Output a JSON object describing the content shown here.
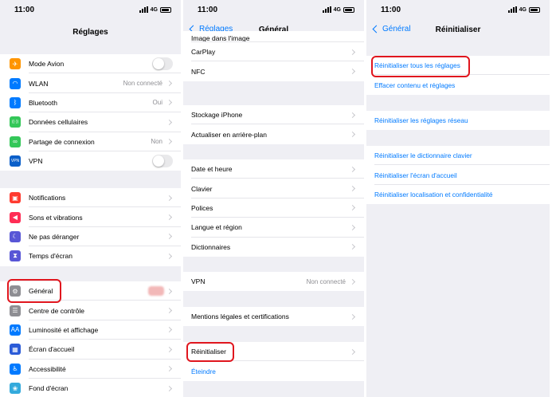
{
  "status": {
    "time": "11:00",
    "network": "4G"
  },
  "panel1": {
    "title": "Réglages",
    "group1": [
      {
        "label": "Mode Avion",
        "icon": "airplane-icon",
        "color": "#ff9500",
        "glyph": "✈",
        "toggle": true
      },
      {
        "label": "WLAN",
        "value": "Non connecté",
        "icon": "wifi-icon",
        "color": "#007aff",
        "glyph": "◠"
      },
      {
        "label": "Bluetooth",
        "value": "Oui",
        "icon": "bluetooth-icon",
        "color": "#007aff",
        "glyph": "ᛒ"
      },
      {
        "label": "Données cellulaires",
        "icon": "cellular-icon",
        "color": "#34c759",
        "glyph": "((·))"
      },
      {
        "label": "Partage de connexion",
        "value": "Non",
        "icon": "hotspot-icon",
        "color": "#34c759",
        "glyph": "∞"
      },
      {
        "label": "VPN",
        "icon": "vpn-icon",
        "color": "#0a5fc9",
        "glyph": "VPN",
        "toggle": true
      }
    ],
    "group2": [
      {
        "label": "Notifications",
        "icon": "notifications-icon",
        "color": "#ff3b30",
        "glyph": "▣"
      },
      {
        "label": "Sons et vibrations",
        "icon": "sound-icon",
        "color": "#ff2d55",
        "glyph": "◀"
      },
      {
        "label": "Ne pas déranger",
        "icon": "moon-icon",
        "color": "#5856d6",
        "glyph": "☾"
      },
      {
        "label": "Temps d'écran",
        "icon": "hourglass-icon",
        "color": "#5856d6",
        "glyph": "⧗"
      }
    ],
    "group3": [
      {
        "label": "Général",
        "icon": "gear-icon",
        "color": "#8e8e93",
        "glyph": "⚙"
      },
      {
        "label": "Centre de contrôle",
        "icon": "control-center-icon",
        "color": "#8e8e93",
        "glyph": "☰"
      },
      {
        "label": "Luminosité et affichage",
        "icon": "brightness-icon",
        "color": "#007aff",
        "glyph": "AA"
      },
      {
        "label": "Écran d'accueil",
        "icon": "home-screen-icon",
        "color": "#2b5bd7",
        "glyph": "▦"
      },
      {
        "label": "Accessibilité",
        "icon": "accessibility-icon",
        "color": "#007aff",
        "glyph": "♿"
      },
      {
        "label": "Fond d'écran",
        "icon": "wallpaper-icon",
        "color": "#34aadc",
        "glyph": "❀"
      }
    ]
  },
  "panel2": {
    "back": "Réglages",
    "title": "Général",
    "group1": [
      "Image dans l'image",
      "CarPlay",
      "NFC"
    ],
    "group2": [
      "Stockage iPhone",
      "Actualiser en arrière-plan"
    ],
    "group3": [
      "Date et heure",
      "Clavier",
      "Polices",
      "Langue et région",
      "Dictionnaires"
    ],
    "group4": [
      {
        "label": "VPN",
        "value": "Non connecté"
      }
    ],
    "group5": [
      "Mentions légales et certifications"
    ],
    "group6": [
      "Réinitialiser"
    ],
    "link": "Éteindre"
  },
  "panel3": {
    "back": "Général",
    "title": "Réinitialiser",
    "group1": [
      "Réinitialiser tous les réglages",
      "Effacer contenu et réglages"
    ],
    "group2": [
      "Réinitialiser les réglages réseau"
    ],
    "group3": [
      "Réinitialiser le dictionnaire clavier",
      "Réinitialiser l'écran d'accueil",
      "Réinitialiser localisation et confidentialité"
    ]
  }
}
